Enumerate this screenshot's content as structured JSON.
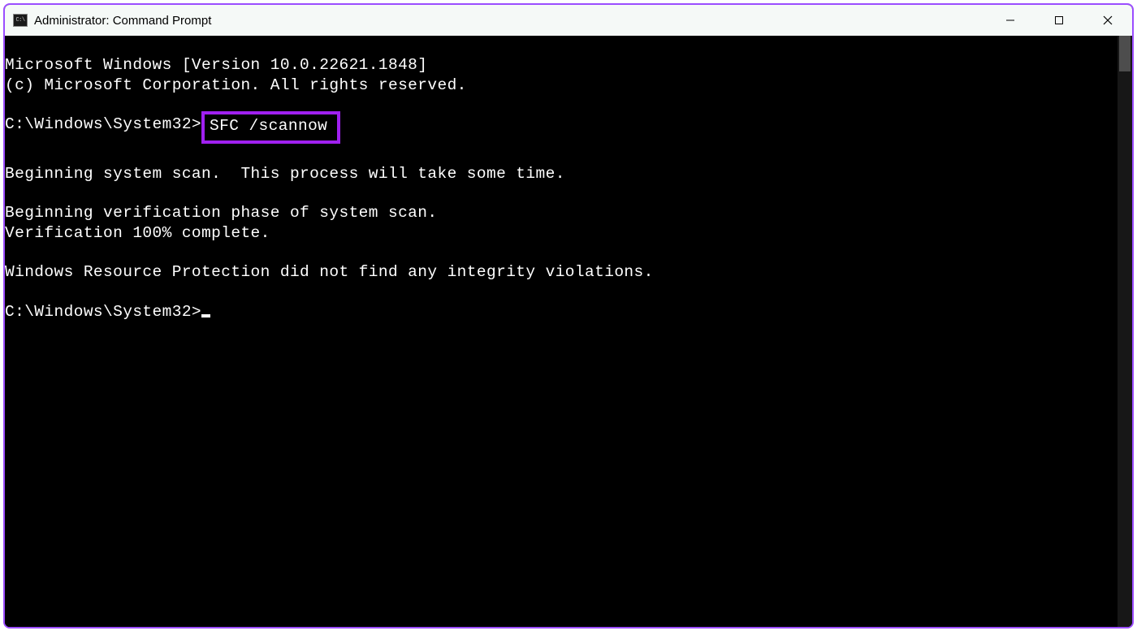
{
  "window": {
    "title": "Administrator: Command Prompt",
    "icon_label": "C:\\"
  },
  "terminal": {
    "header_line1": "Microsoft Windows [Version 10.0.22621.1848]",
    "header_line2": "(c) Microsoft Corporation. All rights reserved.",
    "prompt1_path": "C:\\Windows\\System32>",
    "command": "SFC /scannow",
    "out_line1": "Beginning system scan.  This process will take some time.",
    "out_line2": "Beginning verification phase of system scan.",
    "out_line3": "Verification 100% complete.",
    "out_line4": "Windows Resource Protection did not find any integrity violations.",
    "prompt2_path": "C:\\Windows\\System32>"
  },
  "annotation": {
    "highlight_color": "#a020f0"
  }
}
